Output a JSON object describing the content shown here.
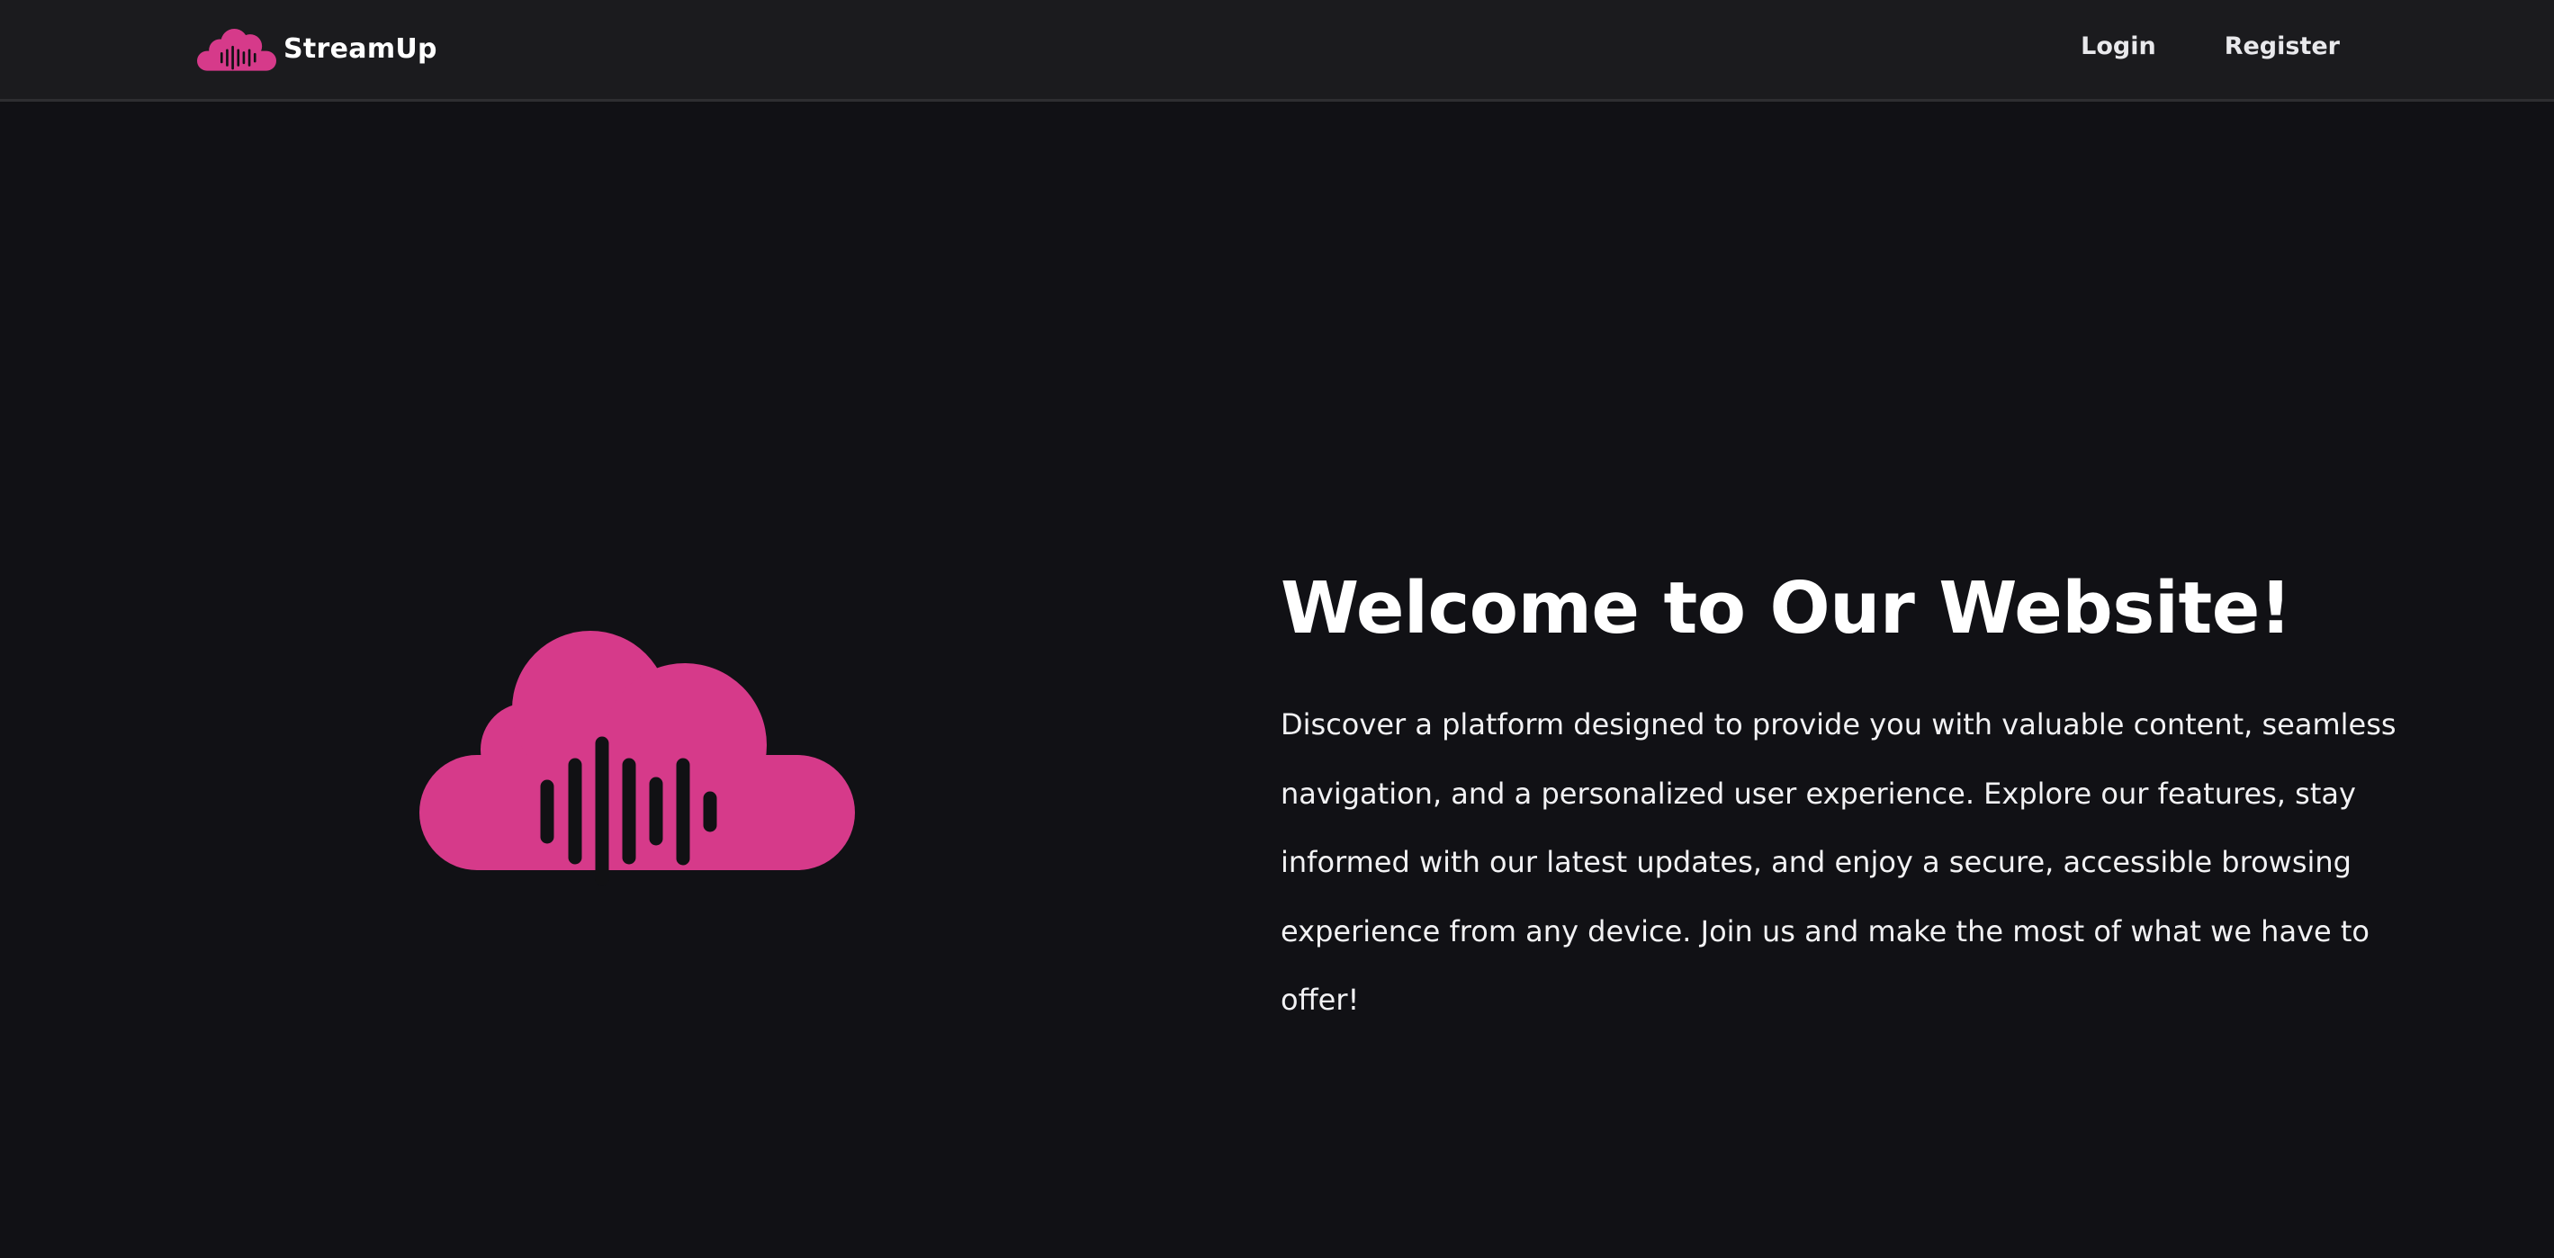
{
  "nav": {
    "brand_name": "StreamUp",
    "links": [
      {
        "label": "Login"
      },
      {
        "label": "Register"
      }
    ]
  },
  "hero": {
    "title": "Welcome to Our Website!",
    "description": "Discover a platform designed to provide you with valuable content, seamless navigation, and a personalized user experience. Explore our features, stay informed with our latest updates, and enjoy a secure, accessible browsing experience from any device. Join us and make the most of what we have to offer!",
    "illustration_icon": "cloud-soundwave-icon"
  },
  "colors": {
    "accent": "#d63a8a",
    "background": "#111115",
    "navbar": "#1b1b1e",
    "text": "#ffffff"
  }
}
